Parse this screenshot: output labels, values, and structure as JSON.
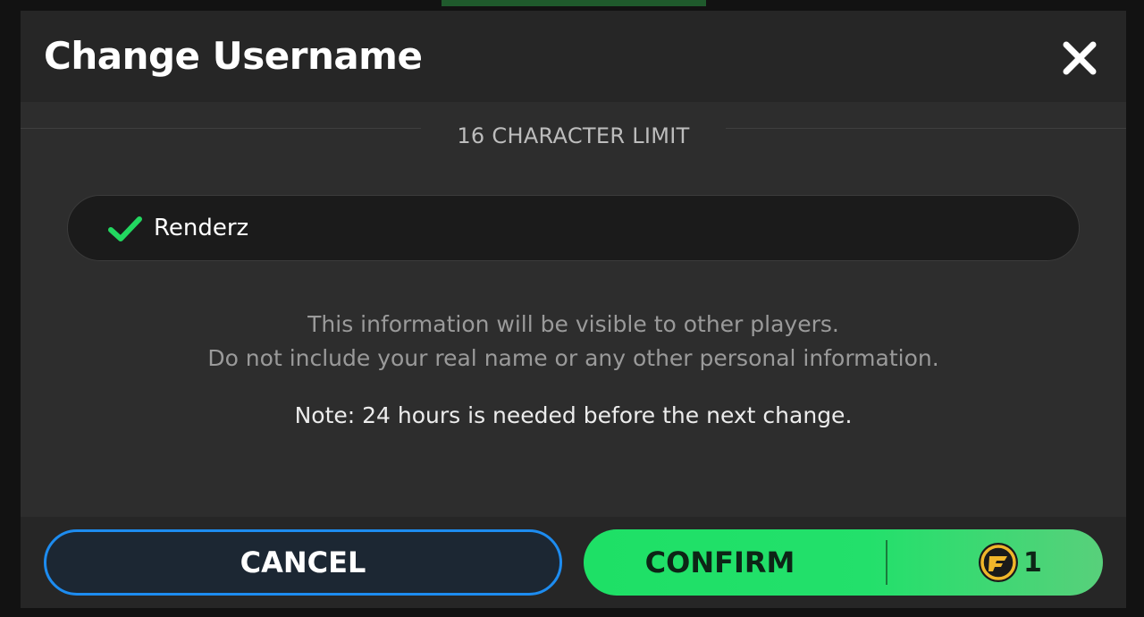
{
  "modal": {
    "title": "Change Username",
    "limit_label": "16 CHARACTER LIMIT",
    "username_value": "Renderz",
    "info_line_1": "This information will be visible to other players.",
    "info_line_2": "Do not include your real name or any other personal information.",
    "note": "Note: 24 hours is needed before the next change.",
    "cancel_label": "CANCEL",
    "confirm_label": "CONFIRM",
    "cost_value": "1"
  },
  "icons": {
    "close": "close-icon",
    "valid": "check-icon",
    "currency": "coin-icon"
  },
  "colors": {
    "accent_green": "#22e06a",
    "accent_blue": "#1d8cf0",
    "panel": "#2d2d2d"
  }
}
